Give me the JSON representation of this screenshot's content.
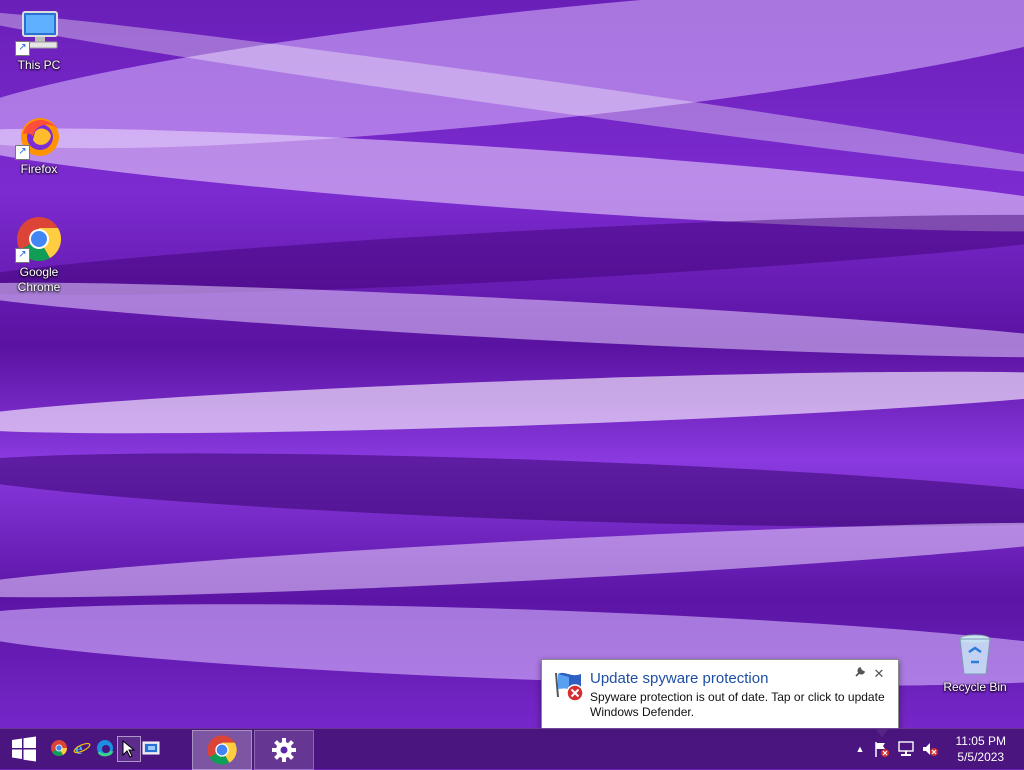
{
  "desktop": {
    "icons": [
      {
        "label": "This PC",
        "icon": "computer-icon"
      },
      {
        "label": "Firefox",
        "icon": "firefox-icon"
      },
      {
        "label": "Google Chrome",
        "icon": "chrome-icon"
      },
      {
        "label": "Recycle Bin",
        "icon": "recycle-bin-icon"
      }
    ]
  },
  "notification": {
    "title": "Update spyware protection",
    "body": "Spyware protection is out of date. Tap or click to update Windows Defender.",
    "icon": "windows-defender-error-icon",
    "settings_icon": "wrench-icon",
    "close_label": "✕"
  },
  "taskbar": {
    "start_icon": "windows-logo-icon",
    "quick_launch": [
      "chrome-icon",
      "internet-explorer-icon",
      "edge-icon",
      "show-desktop-cursor-icon",
      "remote-desktop-icon"
    ],
    "running_apps": [
      "Google Chrome",
      "Settings"
    ],
    "tray": {
      "overflow_label": "▲",
      "icons": [
        "action-center-flag-icon",
        "network-icon",
        "volume-muted-icon"
      ],
      "time": "11:05 PM",
      "date": "5/5/2023"
    }
  },
  "colors": {
    "wallpaper_primary": "#7c2bd0",
    "taskbar": "#46147a",
    "notification_title": "#1e4fa3",
    "error_red": "#d32f2f"
  }
}
